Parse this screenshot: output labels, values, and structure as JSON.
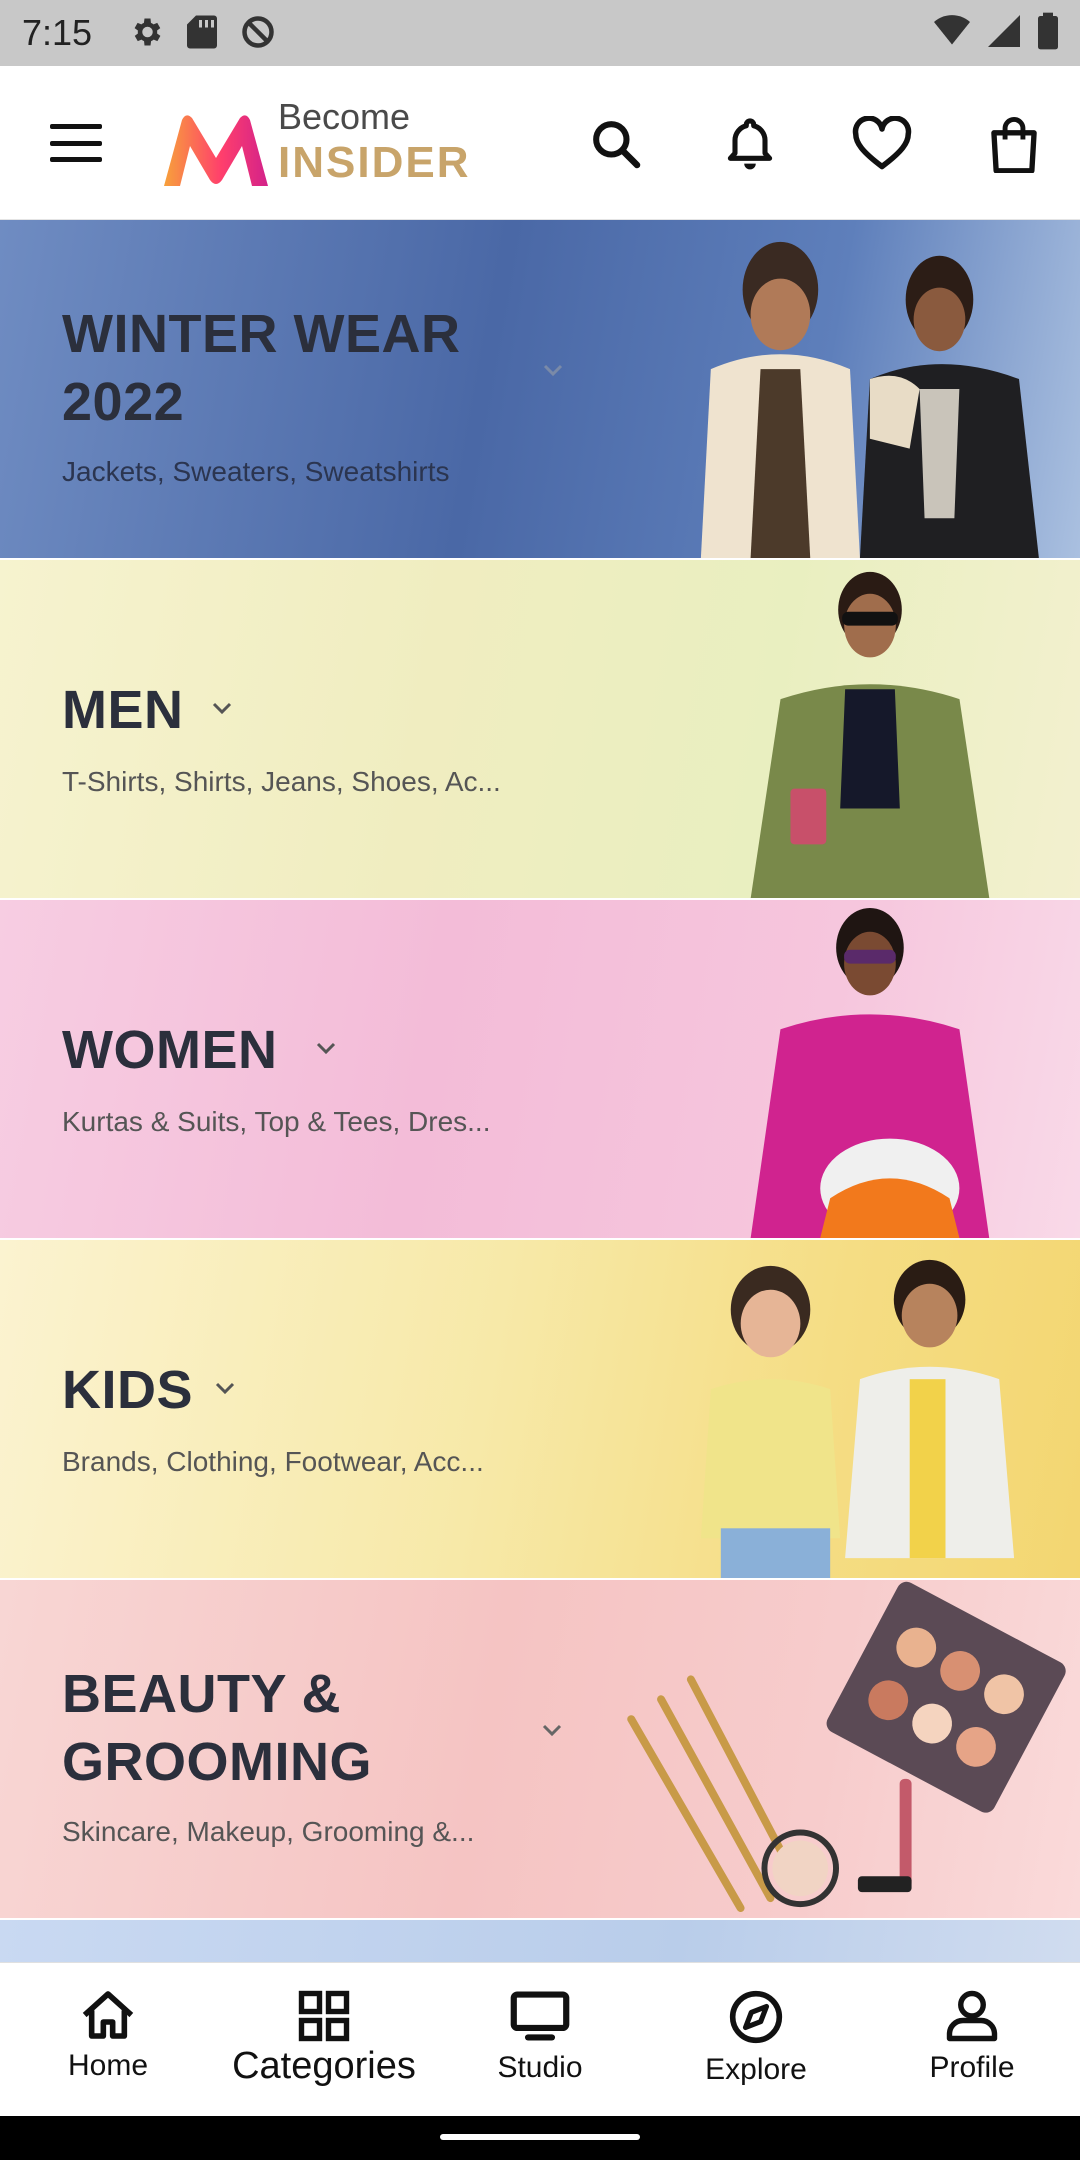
{
  "status_bar": {
    "time": "7:15",
    "left_icons": [
      "settings-icon",
      "sd-card-icon",
      "data-saver-icon"
    ],
    "right_icons": [
      "wifi-icon",
      "cellular-icon",
      "battery-icon"
    ]
  },
  "header": {
    "logo_line1": "Become",
    "logo_line2": "INSIDER",
    "icons": [
      "search-icon",
      "bell-icon",
      "heart-icon",
      "bag-icon"
    ]
  },
  "categories": [
    {
      "title": "WINTER WEAR",
      "title2": "2022",
      "subtitle": "Jackets, Sweaters, Sweatshirts",
      "bg": "#4f6fa8"
    },
    {
      "title": "MEN",
      "title2": "",
      "subtitle": "T-Shirts, Shirts, Jeans, Shoes, Ac...",
      "bg": "#f2efc3"
    },
    {
      "title": "WOMEN",
      "title2": "",
      "subtitle": "Kurtas & Suits, Top & Tees, Dres...",
      "bg": "#f5c4dd"
    },
    {
      "title": "KIDS",
      "title2": "",
      "subtitle": "Brands, Clothing, Footwear, Acc...",
      "bg": "#f7e59a"
    },
    {
      "title": "BEAUTY &",
      "title2": "GROOMING",
      "subtitle": "Skincare, Makeup, Grooming &...",
      "bg": "#f7c9c9"
    }
  ],
  "bottom_nav": [
    {
      "label": "Home",
      "icon": "home-icon"
    },
    {
      "label": "Categories",
      "icon": "grid-icon",
      "active": true
    },
    {
      "label": "Studio",
      "icon": "tv-icon"
    },
    {
      "label": "Explore",
      "icon": "compass-icon"
    },
    {
      "label": "Profile",
      "icon": "person-icon"
    }
  ],
  "colors": {
    "brand_pink": "#ff3f6c",
    "brand_orange": "#f7a13b",
    "insider_gold": "#c8a46a",
    "title_text": "#2b2f3c"
  }
}
